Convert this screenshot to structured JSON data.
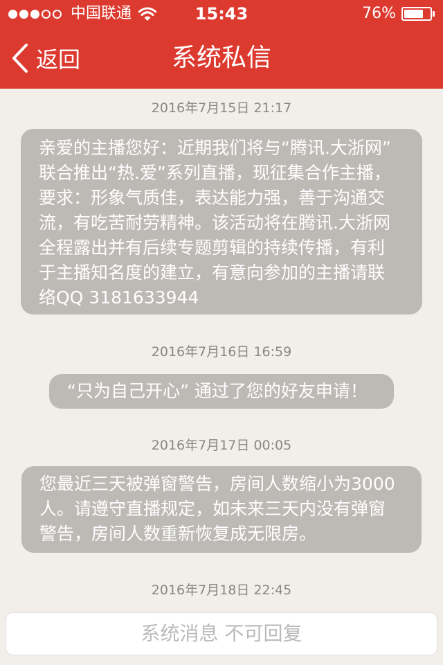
{
  "status_bar": {
    "carrier": "中国联通",
    "time": "15:43",
    "battery_percent_text": "76%",
    "battery_level": 0.76,
    "signal_bars_filled": 3,
    "signal_bars_total": 5
  },
  "nav": {
    "back_label": "返回",
    "title": "系统私信"
  },
  "messages": [
    {
      "timestamp": "2016年7月15日 21:17",
      "lines": [
        "亲爱的主播您好：近期我们将与“腾讯.大浙网”",
        "联合推出“热.爱”系列直播，现征集合作主播，",
        "要求：形象气质佳，表达能力强，善于沟通交",
        "流，有吃苦耐劳精神。该活动将在腾讯.大浙网",
        "全程露出并有后续专题剪辑的持续传播，有利",
        "于主播知名度的建立，有意向参加的主播请联",
        "络QQ 3181633944"
      ]
    },
    {
      "timestamp": "2016年7月16日 16:59",
      "lines": [
        "“只为自己开心” 通过了您的好友申请！"
      ]
    },
    {
      "timestamp": "2016年7月17日 00:05",
      "lines": [
        "您最近三天被弹窗警告，房间人数缩小为3000",
        "人。请遵守直播规定，如未来三天内没有弹窗",
        "警告，房间人数重新恢复成无限房。"
      ]
    },
    {
      "timestamp": "2016年7月18日 22:45",
      "lines": []
    }
  ],
  "footer": {
    "input_placeholder": "系统消息 不可回复"
  },
  "colors": {
    "header": "#dd3a2f",
    "background": "#f2efeb",
    "bubble": "#bdbab6",
    "timestamp": "#8a8782"
  },
  "icons": [
    "wifi-icon",
    "battery-icon",
    "back-chevron-icon"
  ]
}
